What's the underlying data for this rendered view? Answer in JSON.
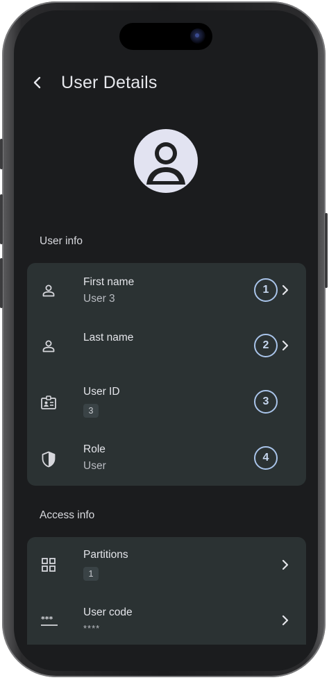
{
  "header": {
    "title": "User Details",
    "back_icon": "chevron-left-icon"
  },
  "avatar": {
    "icon": "person-icon",
    "background": "#e2e3f1",
    "foreground": "#1f2022"
  },
  "user_info": {
    "section_label": "User info",
    "rows": [
      {
        "label": "First name",
        "value": "User 3",
        "icon": "person-outline-icon",
        "badge": "1",
        "has_chevron": true
      },
      {
        "label": "Last name",
        "value": "",
        "icon": "person-outline-icon",
        "badge": "2",
        "has_chevron": true
      },
      {
        "label": "User ID",
        "value": "3",
        "icon": "id-card-icon",
        "badge": "3",
        "has_chevron": false
      },
      {
        "label": "Role",
        "value": "User",
        "icon": "shield-icon",
        "badge": "4",
        "has_chevron": false
      }
    ]
  },
  "access_info": {
    "section_label": "Access info",
    "rows": [
      {
        "label": "Partitions",
        "value": "1",
        "icon": "grid-icon",
        "has_chevron": true
      },
      {
        "label": "User code",
        "value": "****",
        "icon": "password-icon",
        "has_chevron": true
      }
    ]
  },
  "colors": {
    "background": "#1b1c1e",
    "card": "#2b3233",
    "badge_ring": "#a9c4ea",
    "text_primary": "#e4e5ea",
    "text_secondary": "#b9bcc2"
  }
}
